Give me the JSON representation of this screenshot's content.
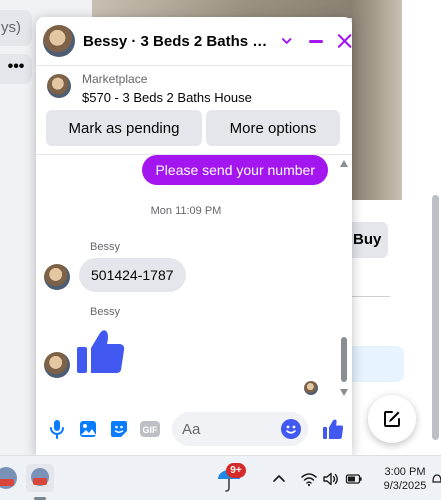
{
  "background": {
    "left_pill_text": "ys)",
    "more_dots": "•••",
    "buy_button_label": "Buy"
  },
  "chat": {
    "title": "Bessy · 3 Beds 2 Baths Hou...",
    "listing": {
      "label": "Marketplace",
      "title": "$570 - 3 Beds 2 Baths House"
    },
    "actions": {
      "pending_label": "Mark as pending",
      "more_label": "More options"
    },
    "messages": {
      "sent_text": "Please send your number",
      "timestamp": "Mon 11:09 PM",
      "sender_1": "Bessy",
      "received_text": "501424-1787",
      "sender_2": "Bessy"
    },
    "composer": {
      "placeholder": "Aa",
      "gif_label": "GIF"
    }
  },
  "taskbar": {
    "notification_badge": "9+",
    "time": "3:00 PM",
    "date": "9/3/2025"
  },
  "colors": {
    "accent": "#a416f0",
    "like_blue": "#4159f0",
    "icon_blue": "#0a7cff"
  }
}
